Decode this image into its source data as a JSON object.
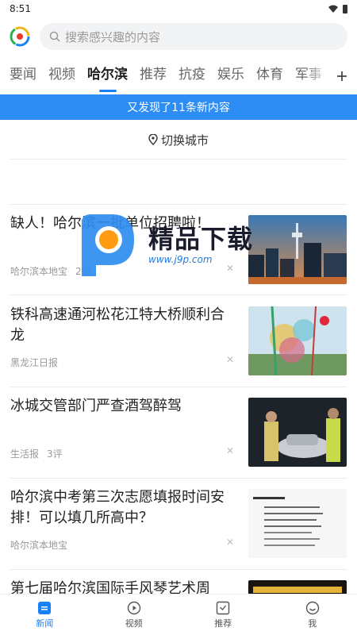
{
  "status_bar": {
    "time": "8:51"
  },
  "search": {
    "placeholder": "搜索感兴趣的内容"
  },
  "tabs": [
    "要闻",
    "视频",
    "哈尔滨",
    "推荐",
    "抗疫",
    "娱乐",
    "体育",
    "军事"
  ],
  "active_tab": "哈尔滨",
  "refresh_banner": "又发现了11条新内容",
  "city_switch": "切换城市",
  "news": [
    {
      "title": "缺人！哈尔滨一批单位招聘啦！",
      "source": "哈尔滨本地宝",
      "comments": "2评",
      "thumb": "city-skyline"
    },
    {
      "title": "铁科高速通河松花江特大桥顺利合龙",
      "source": "黑龙江日报",
      "comments": "",
      "thumb": "bridge-celebration"
    },
    {
      "title": "冰城交管部门严查酒驾醉驾",
      "source": "生活报",
      "comments": "3评",
      "thumb": "police-night"
    },
    {
      "title": "哈尔滨中考第三次志愿填报时间安排！可以填几所高中？",
      "source": "哈尔滨本地宝",
      "comments": "",
      "thumb": "document"
    },
    {
      "title": "第七届哈尔滨国际手风琴艺术周",
      "source": "",
      "comments": "",
      "thumb": "event-banner"
    }
  ],
  "watermark": {
    "text": "精品下载",
    "url": "www.j9p.com"
  },
  "bottom_nav": [
    {
      "label": "新闻",
      "icon": "news-icon"
    },
    {
      "label": "视频",
      "icon": "video-play-icon"
    },
    {
      "label": "推荐",
      "icon": "recommend-icon"
    },
    {
      "label": "我",
      "icon": "profile-smile-icon"
    }
  ],
  "colors": {
    "accent": "#1a82f7",
    "banner": "#2e8df5"
  }
}
